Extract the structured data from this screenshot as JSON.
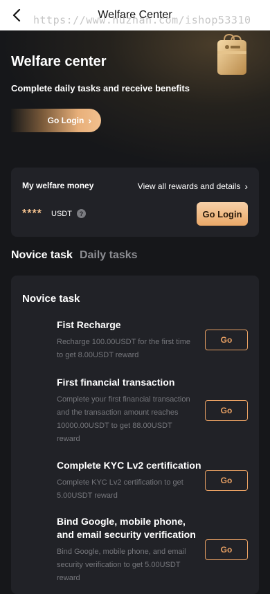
{
  "nav": {
    "title": "Welfare Center",
    "watermark": "https://www.huzhan.com/ishop53310"
  },
  "hero": {
    "title": "Welfare center",
    "subtitle": "Complete daily tasks and receive benefits",
    "login_label": "Go Login"
  },
  "money": {
    "label": "My welfare money",
    "view_all": "View all rewards and details",
    "amount": "****",
    "unit": "USDT",
    "login_button": "Go Login"
  },
  "tabs": [
    "Novice task",
    "Daily tasks"
  ],
  "tasks_card": {
    "title": "Novice task",
    "tasks": [
      {
        "title": "Fist Recharge",
        "desc": "Recharge 100.00USDT for the first time to get 8.00USDT reward",
        "button": "Go"
      },
      {
        "title": "First financial transaction",
        "desc": "Complete your first financial transaction and the transaction amount reaches 10000.00USDT to get 88.00USDT reward",
        "button": "Go"
      },
      {
        "title": "Complete KYC Lv2 certification",
        "desc": "Complete KYC Lv2 certification to get 5.00USDT reward",
        "button": "Go"
      },
      {
        "title": "Bind Google, mobile phone, and email security verification",
        "desc": "Bind Google, mobile phone, and email security verification to get 5.00USDT reward",
        "button": "Go"
      }
    ]
  },
  "colors": {
    "accent": "#e8a063",
    "background": "#16171a",
    "card": "#212227"
  }
}
